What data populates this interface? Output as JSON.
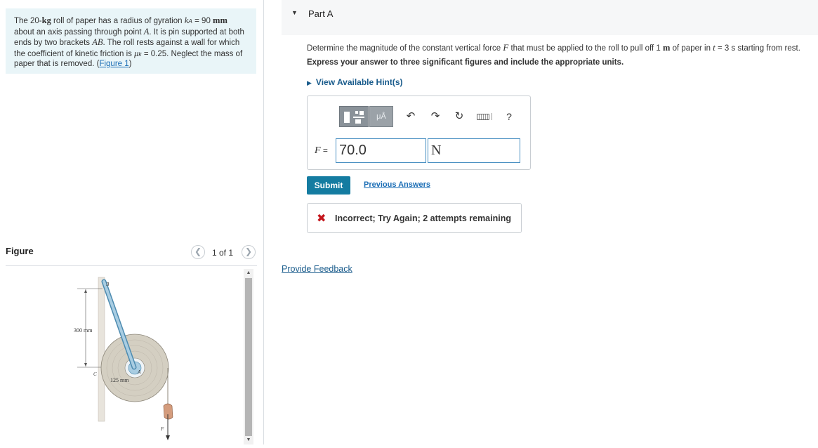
{
  "problem": {
    "text_1": "The 20-",
    "unit_kg": "kg",
    "text_2": " roll of paper has a radius of gyration ",
    "sym_k": "k",
    "sub_A": "A",
    "text_3": " = 90 ",
    "unit_mm": "mm",
    "text_4": " about an axis passing through point ",
    "sym_A": "A",
    "text_5": ". It is pin supported at both ends by two brackets ",
    "sym_AB": "AB",
    "text_6": ". The roll rests against a wall for which the coefficient of kinetic friction is ",
    "sym_mu": "μ",
    "sub_k": "k",
    "text_7": " = 0.25. Neglect the mass of paper that is removed. (",
    "figure_link": "Figure 1",
    "text_8": ")"
  },
  "figure": {
    "title": "Figure",
    "page_count": "1 of 1",
    "prev_icon": "chevron-left-icon",
    "next_icon": "chevron-right-icon",
    "labels": {
      "B": "B",
      "C": "C",
      "A": "A",
      "F": "F",
      "dim_300": "300 mm",
      "dim_125": "125 mm"
    }
  },
  "part": {
    "caret": "▼",
    "title": "Part A"
  },
  "question": {
    "text_1": "Determine the magnitude of the constant vertical force ",
    "sym_F": "F",
    "text_2": " that must be applied to the roll to pull off 1 ",
    "unit_m": "m",
    "text_3": " of paper in ",
    "sym_t": "t",
    "text_4": " = 3 s starting from rest.",
    "instruction": "Express your answer to three significant figures and include the appropriate units.",
    "hints": "View Available Hint(s)"
  },
  "answer": {
    "variable": "F",
    "equals": " =",
    "value": "70.0",
    "unit": "N",
    "toolbar": {
      "templates_icon": "templates-icon",
      "units_label": "μÅ",
      "undo_glyph": "↶",
      "redo_glyph": "↷",
      "reset_glyph": "↻",
      "help_label": "?"
    }
  },
  "actions": {
    "submit": "Submit",
    "previous_answers": "Previous Answers",
    "provide_feedback": "Provide Feedback"
  },
  "feedback": {
    "icon": "✖",
    "message": "Incorrect; Try Again; 2 attempts remaining"
  },
  "colors": {
    "accent": "#147ca1",
    "link": "#1a6db5",
    "error": "#c4161c",
    "problem_bg": "#e9f5f8"
  }
}
